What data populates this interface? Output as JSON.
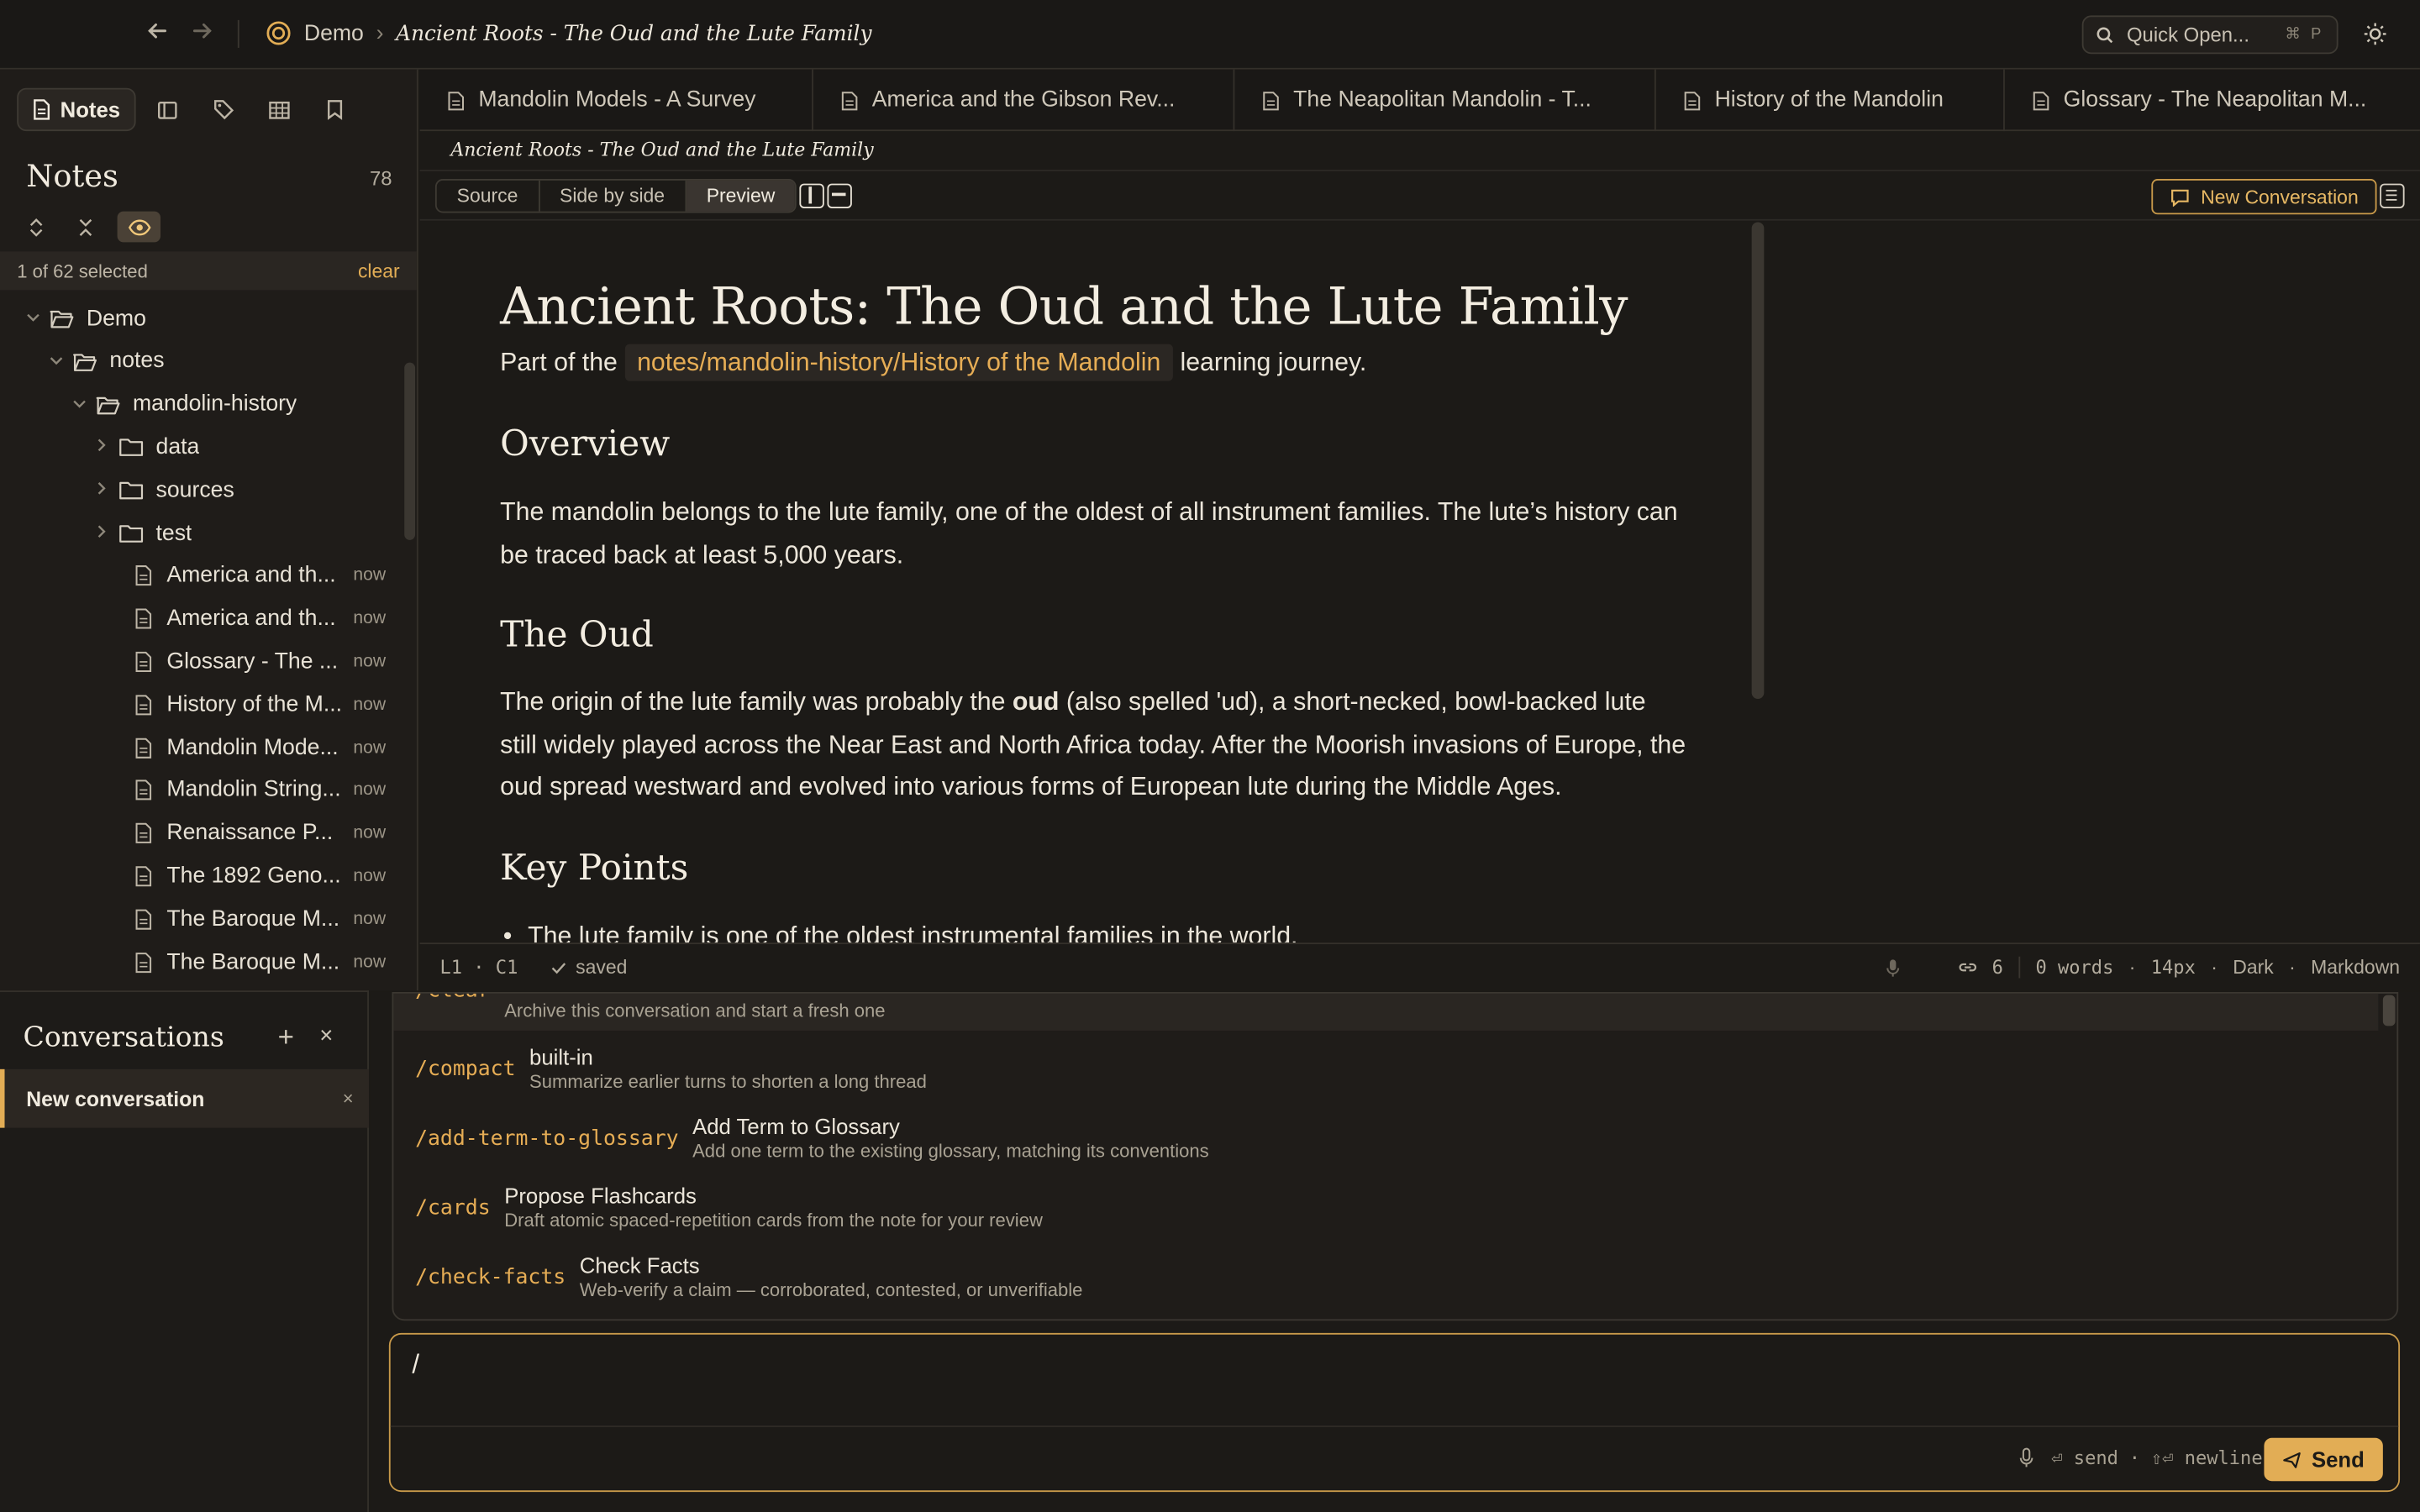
{
  "topbar": {
    "back_icon": "arrow-left-icon",
    "forward_icon": "arrow-right-icon",
    "workspace": "Demo",
    "separator": "›",
    "document": "Ancient Roots - The Oud and the Lute Family",
    "quick_open": "Quick Open...",
    "quick_open_kbd": "⌘ P",
    "theme_icon": "sun-icon"
  },
  "sidebar": {
    "tabs": [
      {
        "label": "Notes",
        "icon": "note-icon"
      },
      {
        "icon": "layout-icon"
      },
      {
        "icon": "tag-icon"
      },
      {
        "icon": "table-icon"
      },
      {
        "icon": "bookmark-icon"
      }
    ],
    "title": "Notes",
    "count": "78",
    "selection": "1 of 62 selected",
    "clear": "clear",
    "tree": [
      {
        "label": "Demo",
        "type": "folder",
        "depth": 0,
        "open": true
      },
      {
        "label": "notes",
        "type": "folder",
        "depth": 1,
        "open": true
      },
      {
        "label": "mandolin-history",
        "type": "folder",
        "depth": 2,
        "open": true
      },
      {
        "label": "data",
        "type": "folder",
        "depth": 3,
        "open": false
      },
      {
        "label": "sources",
        "type": "folder",
        "depth": 3,
        "open": false
      },
      {
        "label": "test",
        "type": "folder",
        "depth": 3,
        "open": false
      },
      {
        "label": "America and th...",
        "type": "file",
        "depth": 3,
        "time": "now"
      },
      {
        "label": "America and th...",
        "type": "file",
        "depth": 3,
        "time": "now"
      },
      {
        "label": "Glossary - The ...",
        "type": "file",
        "depth": 3,
        "time": "now"
      },
      {
        "label": "History of the M...",
        "type": "file",
        "depth": 3,
        "time": "now"
      },
      {
        "label": "Mandolin Mode...",
        "type": "file",
        "depth": 3,
        "time": "now"
      },
      {
        "label": "Mandolin String...",
        "type": "file",
        "depth": 3,
        "time": "now"
      },
      {
        "label": "Renaissance P...",
        "type": "file",
        "depth": 3,
        "time": "now"
      },
      {
        "label": "The 1892 Geno...",
        "type": "file",
        "depth": 3,
        "time": "now"
      },
      {
        "label": "The Baroque M...",
        "type": "file",
        "depth": 3,
        "time": "now"
      },
      {
        "label": "The Baroque M...",
        "type": "file",
        "depth": 3,
        "time": "now"
      }
    ]
  },
  "editor": {
    "tabs": [
      "Mandolin Models - A Survey",
      "America and the Gibson Rev...",
      "The Neapolitan Mandolin - T...",
      "History of the Mandolin",
      "Glossary - The Neapolitan M..."
    ],
    "caption": "Ancient Roots - The Oud and the Lute Family",
    "modes": [
      "Source",
      "Side by side",
      "Preview"
    ],
    "active_mode": "Preview",
    "new_conversation": "New Conversation",
    "doc": {
      "h1": "Ancient Roots: The Oud and the Lute Family",
      "intro_before": "Part of the",
      "intro_link": "notes/mandolin-history/History of the Mandolin",
      "intro_after": "learning journey.",
      "h2_overview": "Overview",
      "p_overview": "The mandolin belongs to the lute family, one of the oldest of all instrument families. The lute’s history can be traced back at least 5,000 years.",
      "h2_oud": "The Oud",
      "p_oud_1": "The origin of the lute family was probably the",
      "p_oud_bold": "oud",
      "p_oud_2": "(also spelled 'ud), a short-necked, bowl-backed lute still widely played across the Near East and North Africa today. After the Moorish invasions of Europe, the oud spread westward and evolved into various forms of European lute during the Middle Ages.",
      "h2_key": "Key Points",
      "bullet_1": "The lute family is one of the oldest instrumental families in the world."
    },
    "status": {
      "position": "L1 · C1",
      "saved": "saved",
      "links": "6",
      "words": "0 words",
      "font_size": "14px",
      "theme": "Dark",
      "mode": "Markdown",
      "dot": "·"
    }
  },
  "conversations": {
    "title": "Conversations",
    "add": "+",
    "close": "×",
    "items": [
      {
        "label": "New conversation"
      }
    ]
  },
  "slash_menu": [
    {
      "name": "/clear",
      "title": "",
      "desc": "Archive this conversation and start a fresh one"
    },
    {
      "name": "/compact",
      "title": "built-in",
      "desc": "Summarize earlier turns to shorten a long thread"
    },
    {
      "name": "/add-term-to-glossary",
      "title": "Add Term to Glossary",
      "desc": "Add one term to the existing glossary, matching its conventions"
    },
    {
      "name": "/cards",
      "title": "Propose Flashcards",
      "desc": "Draft atomic spaced-repetition cards from the note for your review"
    },
    {
      "name": "/check-facts",
      "title": "Check Facts",
      "desc": "Web-verify a claim — corroborated, contested, or unverifiable"
    }
  ],
  "composer": {
    "value": "/",
    "hint_send": "⏎ send",
    "hint_sep": "·",
    "hint_newline": "⇧⏎ newline",
    "send": "Send"
  },
  "colors": {
    "accent": "#e2ad55",
    "background": "#1c1a17",
    "text": "#e8e2d6"
  }
}
